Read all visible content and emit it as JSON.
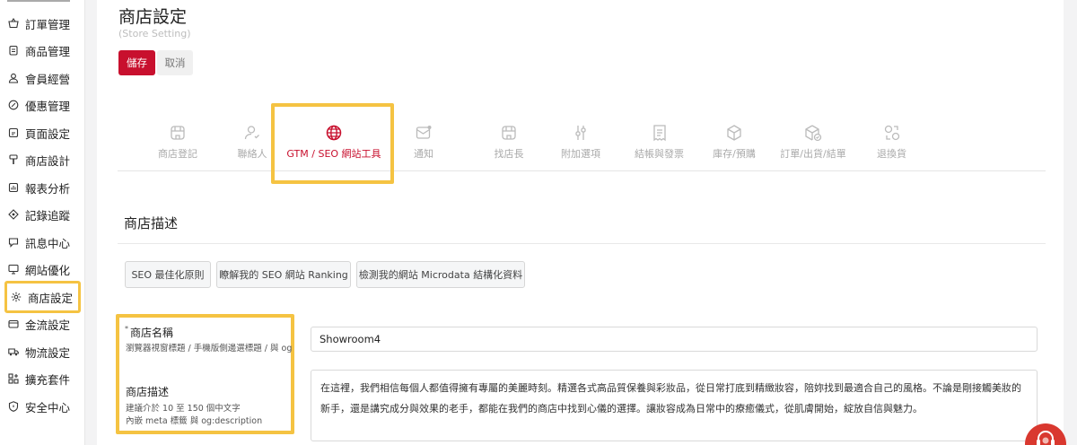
{
  "sidebar": {
    "items": [
      {
        "label": "訂單管理",
        "icon": "basket-icon"
      },
      {
        "label": "商品管理",
        "icon": "clipboard-icon"
      },
      {
        "label": "會員經營",
        "icon": "user-icon"
      },
      {
        "label": "優惠管理",
        "icon": "discount-icon"
      },
      {
        "label": "頁面設定",
        "icon": "page-icon"
      },
      {
        "label": "商店設計",
        "icon": "brush-icon"
      },
      {
        "label": "報表分析",
        "icon": "chart-icon"
      },
      {
        "label": "記錄追蹤",
        "icon": "target-icon"
      },
      {
        "label": "訊息中心",
        "icon": "message-icon"
      },
      {
        "label": "網站優化",
        "icon": "monitor-icon"
      },
      {
        "label": "商店設定",
        "icon": "gear-icon"
      },
      {
        "label": "金流設定",
        "icon": "wallet-icon"
      },
      {
        "label": "物流設定",
        "icon": "truck-icon"
      },
      {
        "label": "擴充套件",
        "icon": "puzzle-icon"
      },
      {
        "label": "安全中心",
        "icon": "shield-icon"
      }
    ]
  },
  "header": {
    "title": "商店設定",
    "subtitle": "(Store Setting)",
    "save_label": "儲存",
    "cancel_label": "取消"
  },
  "tabs": [
    {
      "label": "商店登記",
      "icon": "store-icon"
    },
    {
      "label": "聯絡人",
      "icon": "contact-icon"
    },
    {
      "label": "GTM / SEO 網站工具",
      "icon": "globe-icon"
    },
    {
      "label": "通知",
      "icon": "mail-icon"
    },
    {
      "label": "找店長",
      "icon": "shop-icon"
    },
    {
      "label": "附加選項",
      "icon": "sliders-icon"
    },
    {
      "label": "結帳與發票",
      "icon": "receipt-icon"
    },
    {
      "label": "庫存/預購",
      "icon": "box-icon"
    },
    {
      "label": "訂單/出貨/結單",
      "icon": "package-check-icon"
    },
    {
      "label": "退換貨",
      "icon": "exchange-icon"
    }
  ],
  "active_tab": "GTM / SEO 網站工具",
  "section": {
    "title": "商店描述",
    "buttons": [
      "SEO 最佳化原則",
      "瞭解我的 SEO 網站 Ranking",
      "檢測我的網站 Microdata 結構化資料"
    ]
  },
  "form": {
    "store_name": {
      "label": "商店名稱",
      "required_mark": "*",
      "hint": "瀏覽器視窗標題 / 手機版側邊選標題 / 與 og:title",
      "value": "Showroom4"
    },
    "store_description": {
      "label": "商店描述",
      "hint_line1": "建議介於 10 至 150 個中文字",
      "hint_line2": "內嵌 meta 標籤 與 og:description",
      "value": "在這裡，我們相信每個人都值得擁有專屬的美麗時刻。精選各式高品質保養與彩妝品，從日常打底到精緻妝容，陪妳找到最適合自己的風格。不論是剛接觸美妝的新手，還是講究成分與效果的老手，都能在我們的商店中找到心儀的選擇。讓妝容成為日常中的療癒儀式，從肌膚開始，綻放自信與魅力。"
    }
  },
  "colors": {
    "accent": "#c8102e",
    "highlight": "#f5c342"
  }
}
